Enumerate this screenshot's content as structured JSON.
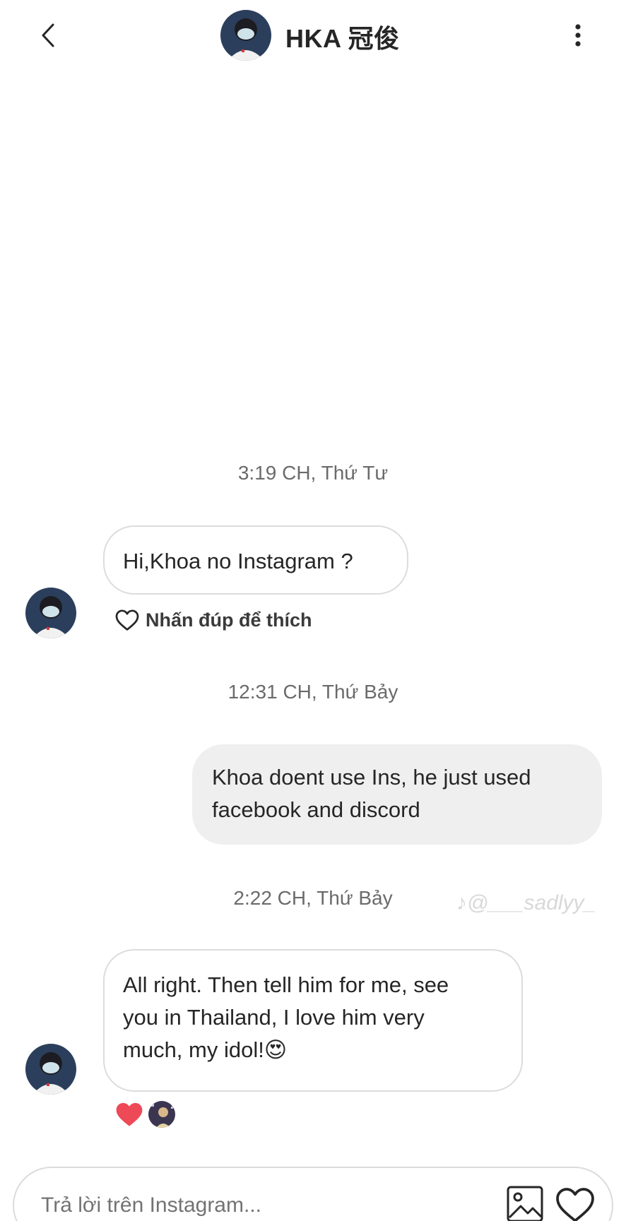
{
  "header": {
    "title": "HKA 冠俊",
    "back_icon": "chevron-left-icon",
    "menu_icon": "more-vertical-icon"
  },
  "messages": [
    {
      "kind": "timestamp",
      "text": "3:19 CH, Thứ Tư"
    },
    {
      "kind": "incoming",
      "text": "Hi,Khoa no Instagram ?"
    },
    {
      "kind": "like_hint",
      "text": "Nhấn đúp để thích",
      "icon": "heart-outline-icon"
    },
    {
      "kind": "timestamp",
      "text": "12:31 CH, Thứ Bảy"
    },
    {
      "kind": "outgoing",
      "lines": [
        "Khoa doent use Ins, he just used",
        "facebook and discord"
      ]
    },
    {
      "kind": "timestamp",
      "text": "2:22 CH, Thứ Bảy"
    },
    {
      "kind": "incoming",
      "lines": [
        "All right. Then tell him for me, see",
        "you in Thailand, I love him very",
        "much, my idol!"
      ],
      "emoji": "😍"
    },
    {
      "kind": "reactions",
      "items": [
        "❤️"
      ],
      "icon": "red-heart-icon"
    }
  ],
  "watermark": "♪@___sadlyy_",
  "composer": {
    "placeholder": "Trả lời trên Instagram...",
    "gallery_icon": "image-gallery-icon",
    "like_icon": "heart-outline-icon"
  },
  "colors": {
    "text": "#262626",
    "timestamp": "#6b6b6b",
    "outgoing_bubble": "#efefef",
    "incoming_border": "#dcdcdc",
    "heart_red": "#ed4956"
  }
}
